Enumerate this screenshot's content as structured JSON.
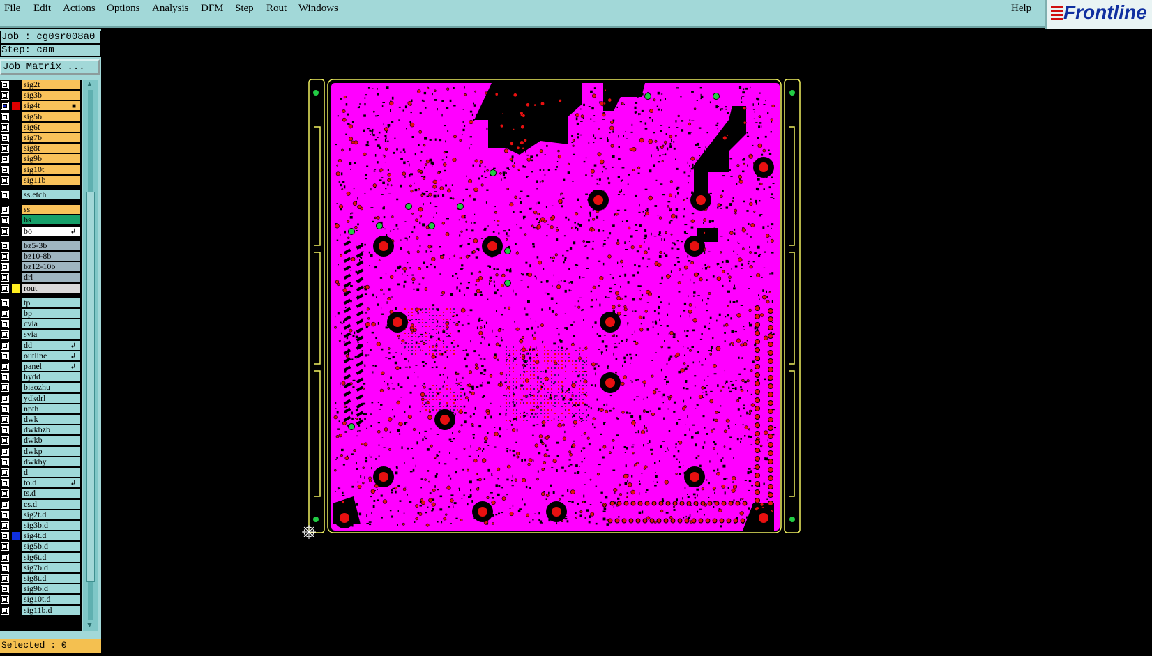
{
  "menu": [
    "File",
    "Edit",
    "Actions",
    "Options",
    "Analysis",
    "DFM",
    "Step",
    "Rout",
    "Windows"
  ],
  "help": "Help",
  "logo": "Frontline",
  "job": "Job : cg0sr008a0",
  "step": "Step: cam",
  "job_matrix": "Job Matrix ...",
  "status": "Selected : 0",
  "colors": {
    "board": "#ff00ff",
    "pad": "#e81010",
    "outline": "#f0f060",
    "via": "#22cc44",
    "panel_bg": "#a2d8d8"
  },
  "layers": [
    {
      "name": "sig2t",
      "bg": "#f9c25a",
      "sw": ""
    },
    {
      "name": "sig3b",
      "bg": "#f9c25a",
      "sw": ""
    },
    {
      "name": "sig4t",
      "bg": "#f9c25a",
      "sw": "#e00000",
      "selected": true,
      "mark": "■"
    },
    {
      "name": "sig5b",
      "bg": "#f9c25a",
      "sw": ""
    },
    {
      "name": "sig6t",
      "bg": "#f9c25a",
      "sw": ""
    },
    {
      "name": "sig7b",
      "bg": "#f9c25a",
      "sw": ""
    },
    {
      "name": "sig8t",
      "bg": "#f9c25a",
      "sw": ""
    },
    {
      "name": "sig9b",
      "bg": "#f9c25a",
      "sw": ""
    },
    {
      "name": "sig10t",
      "bg": "#f9c25a",
      "sw": ""
    },
    {
      "name": "sig11b",
      "bg": "#f9c25a",
      "sw": ""
    },
    {
      "name": "ss.etch",
      "bg": "#9fd9d9",
      "sw": "",
      "gap": true
    },
    {
      "name": "ss",
      "bg": "#f9c25a",
      "sw": "",
      "gap": true
    },
    {
      "name": "bs",
      "bg": "#17a06a",
      "sw": ""
    },
    {
      "name": "bo",
      "bg": "#ffffff",
      "sw": "",
      "mark": "↲"
    },
    {
      "name": "bz5-3b",
      "bg": "#9fb5c0",
      "sw": "",
      "gap": true
    },
    {
      "name": "bz10-8b",
      "bg": "#9fb5c0",
      "sw": ""
    },
    {
      "name": "bz12-10b",
      "bg": "#9fb5c0",
      "sw": ""
    },
    {
      "name": "drl",
      "bg": "#9fb5c0",
      "sw": ""
    },
    {
      "name": "rout",
      "bg": "#d9d9d9",
      "sw": "#ffee20"
    },
    {
      "name": "tp",
      "bg": "#9fd9d9",
      "sw": "",
      "gap": true
    },
    {
      "name": "bp",
      "bg": "#9fd9d9",
      "sw": ""
    },
    {
      "name": "cvia",
      "bg": "#9fd9d9",
      "sw": ""
    },
    {
      "name": "svia",
      "bg": "#9fd9d9",
      "sw": ""
    },
    {
      "name": "dd",
      "bg": "#9fd9d9",
      "sw": "",
      "mark": "↲"
    },
    {
      "name": "outline",
      "bg": "#9fd9d9",
      "sw": "",
      "mark": "↲"
    },
    {
      "name": "panel",
      "bg": "#9fd9d9",
      "sw": "",
      "mark": "↲"
    },
    {
      "name": "hydd",
      "bg": "#9fd9d9",
      "sw": ""
    },
    {
      "name": "biaozhu",
      "bg": "#9fd9d9",
      "sw": ""
    },
    {
      "name": "ydkdrl",
      "bg": "#9fd9d9",
      "sw": ""
    },
    {
      "name": "npth",
      "bg": "#9fd9d9",
      "sw": ""
    },
    {
      "name": "dwk",
      "bg": "#9fd9d9",
      "sw": ""
    },
    {
      "name": "dwkbzb",
      "bg": "#9fd9d9",
      "sw": ""
    },
    {
      "name": "dwkb",
      "bg": "#9fd9d9",
      "sw": ""
    },
    {
      "name": "dwkp",
      "bg": "#9fd9d9",
      "sw": ""
    },
    {
      "name": "dwkby",
      "bg": "#9fd9d9",
      "sw": ""
    },
    {
      "name": "d",
      "bg": "#9fd9d9",
      "sw": ""
    },
    {
      "name": "to.d",
      "bg": "#9fd9d9",
      "sw": "",
      "mark": "↲"
    },
    {
      "name": "ts.d",
      "bg": "#9fd9d9",
      "sw": ""
    },
    {
      "name": "cs.d",
      "bg": "#9fd9d9",
      "sw": ""
    },
    {
      "name": "sig2t.d",
      "bg": "#9fd9d9",
      "sw": ""
    },
    {
      "name": "sig3b.d",
      "bg": "#9fd9d9",
      "sw": ""
    },
    {
      "name": "sig4t.d",
      "bg": "#9fd9d9",
      "sw": "#1030e0"
    },
    {
      "name": "sig5b.d",
      "bg": "#9fd9d9",
      "sw": ""
    },
    {
      "name": "sig6t.d",
      "bg": "#9fd9d9",
      "sw": ""
    },
    {
      "name": "sig7b.d",
      "bg": "#9fd9d9",
      "sw": ""
    },
    {
      "name": "sig8t.d",
      "bg": "#9fd9d9",
      "sw": ""
    },
    {
      "name": "sig9b.d",
      "bg": "#9fd9d9",
      "sw": ""
    },
    {
      "name": "sig10t.d",
      "bg": "#9fd9d9",
      "sw": ""
    },
    {
      "name": "sig11b.d",
      "bg": "#9fd9d9",
      "sw": ""
    }
  ]
}
